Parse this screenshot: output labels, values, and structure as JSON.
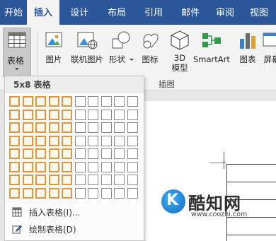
{
  "tabs": [
    "开始",
    "插入",
    "设计",
    "布局",
    "引用",
    "邮件",
    "审阅",
    "视图"
  ],
  "active_tab": "插入",
  "ribbon": {
    "table_label": "表格",
    "buttons": {
      "picture": "图片",
      "online_picture": "联机图片",
      "shapes": "形状",
      "icons": "图标",
      "model3d": "3D\n模型",
      "smartart": "SmartArt",
      "chart": "图表",
      "screenshot": "屏幕"
    },
    "group_label": "插图"
  },
  "dropdown": {
    "header": "5x8 表格",
    "grid_cols": 10,
    "grid_rows": 8,
    "selected_cols": 5,
    "selected_rows": 8,
    "items": [
      "插入表格(I)...",
      "绘制表格(D)"
    ]
  },
  "watermark": {
    "logo_letter": "K",
    "name": "酷知网",
    "url": "www.coozhi.com"
  },
  "colors": {
    "ribbon_blue": "#2b579a",
    "selection_orange": "#e6953a"
  }
}
